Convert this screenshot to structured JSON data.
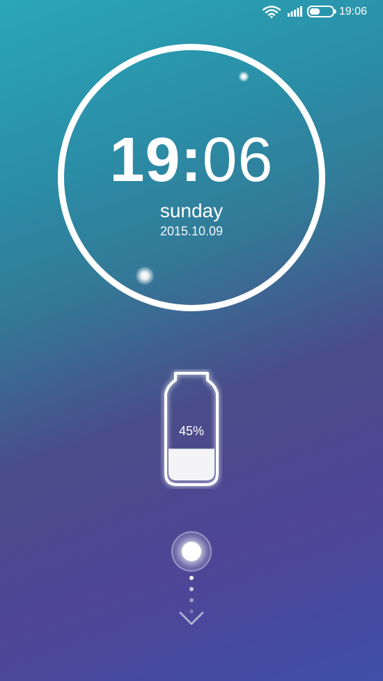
{
  "status_bar": {
    "time": "19:06",
    "icons": [
      "wifi-icon",
      "signal-icon",
      "battery-icon"
    ]
  },
  "clock": {
    "hours": "19",
    "separator": ":",
    "minutes": "06",
    "day": "sunday",
    "date": "2015.10.09"
  },
  "charging": {
    "percent_label": "45%",
    "level": 0.45,
    "icon": "battery-charging-icon"
  },
  "unlock": {
    "icon": "unlock-handle",
    "hint_icon": "chevron-down-icon"
  },
  "colors": {
    "gradient_top": "#2aa7b8",
    "gradient_middle": "#4a4c8a",
    "gradient_bottom": "#3f4fa8",
    "foreground": "#ffffff"
  }
}
